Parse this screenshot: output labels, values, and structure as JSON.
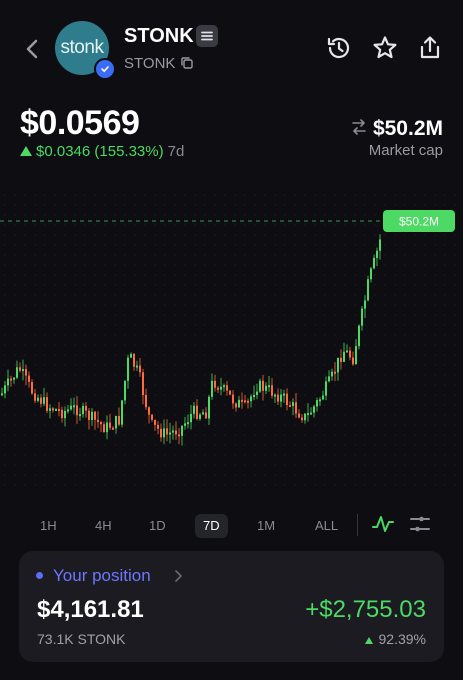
{
  "header": {
    "logo_text": "stonk",
    "token_name": "STONK",
    "ticker": "STONK"
  },
  "price": {
    "current": "$0.0569",
    "change": "$0.0346 (155.33%)",
    "period": "7d",
    "market_cap": "$50.2M",
    "market_cap_label": "Market cap"
  },
  "chart": {
    "last_label": "$50.2M"
  },
  "ranges": [
    {
      "label": "1H",
      "active": false
    },
    {
      "label": "4H",
      "active": false
    },
    {
      "label": "1D",
      "active": false
    },
    {
      "label": "7D",
      "active": true
    },
    {
      "label": "1M",
      "active": false
    },
    {
      "label": "ALL",
      "active": false
    }
  ],
  "position": {
    "title": "Your position",
    "value": "$4,161.81",
    "amount": "73.1K STONK",
    "pnl": "+$2,755.03",
    "pnl_pct": "92.39%"
  },
  "colors": {
    "up": "#4cd964",
    "down": "#ff6b3d",
    "accent": "#6b78ff"
  },
  "icons": [
    "back-chevron-icon",
    "verified-check-icon",
    "menu-lines-icon",
    "copy-icon",
    "history-icon",
    "star-icon",
    "share-icon",
    "swap-arrows-icon",
    "line-chart-icon",
    "settings-sliders-icon",
    "chevron-right-icon"
  ]
}
